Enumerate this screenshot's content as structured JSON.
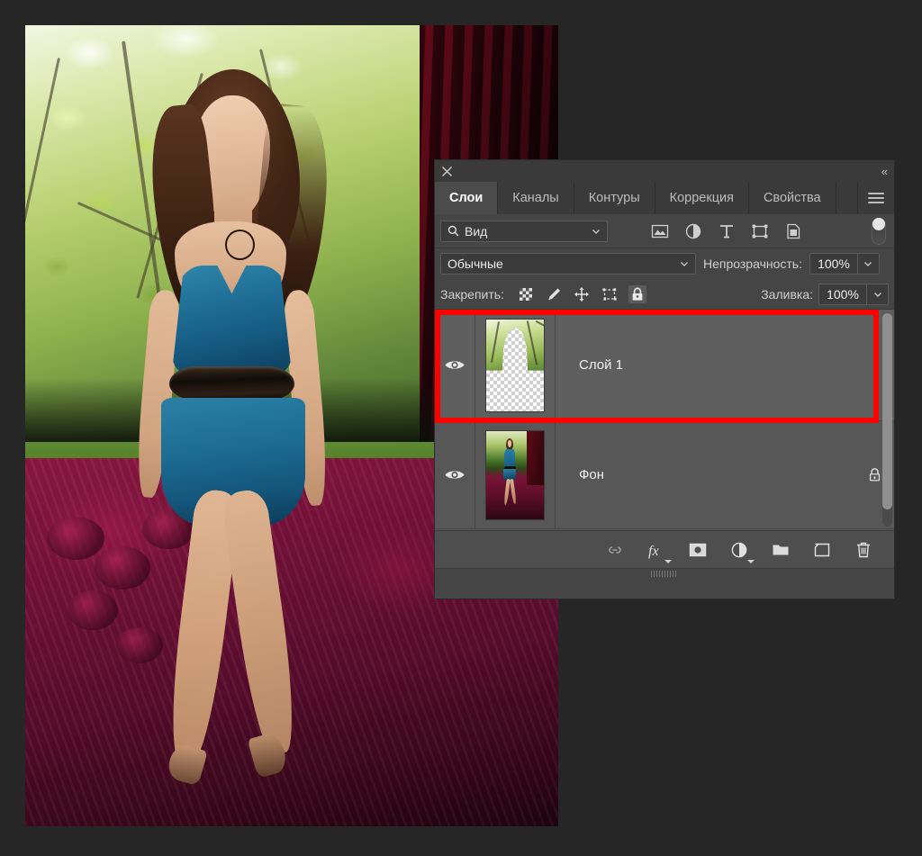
{
  "canvas": {
    "image_alt": "woman-in-blue-dress-on-velvet-sofa"
  },
  "panel": {
    "close_icon": "close-icon",
    "collapse_label": "«",
    "tabs": [
      {
        "label": "Слои",
        "active": true
      },
      {
        "label": "Каналы",
        "active": false
      },
      {
        "label": "Контуры",
        "active": false
      },
      {
        "label": "Коррекция",
        "active": false
      },
      {
        "label": "Свойства",
        "active": false
      }
    ],
    "menu_icon": "hamburger-menu-icon",
    "filter": {
      "kind_label": "Вид",
      "search_icon": "search-icon",
      "icons": [
        "pixel-layer-filter-icon",
        "adjustment-layer-filter-icon",
        "type-layer-filter-icon",
        "shape-layer-filter-icon",
        "smart-object-filter-icon"
      ],
      "toggle": "filter-enable-toggle"
    },
    "blend": {
      "mode": "Обычные",
      "opacity_label": "Непрозрачность:",
      "opacity_value": "100%",
      "fill_label": "Заливка:",
      "fill_value": "100%"
    },
    "lock": {
      "label": "Закрепить:",
      "icons": [
        "lock-transparent-pixels-icon",
        "lock-image-pixels-icon",
        "lock-position-icon",
        "lock-artboard-nesting-icon",
        "lock-all-icon"
      ],
      "active_index": 4
    },
    "layers": [
      {
        "name": "Слой 1",
        "visible": true,
        "selected": true,
        "locked": false,
        "thumb": "cutout-transparent-thumbnail"
      },
      {
        "name": "Фон",
        "visible": true,
        "selected": false,
        "locked": true,
        "thumb": "background-photo-thumbnail"
      }
    ],
    "bottom_icons": [
      "link-layers-icon",
      "layer-style-fx-icon",
      "add-layer-mask-icon",
      "new-adjustment-layer-icon",
      "new-group-icon",
      "new-layer-icon",
      "delete-layer-icon"
    ],
    "bottom_fx_label": "fx"
  },
  "colors": {
    "highlight": "#ff0000",
    "panel_bg": "#454545",
    "tab_bar": "#3a3a3a",
    "layer_row": "#5e5e5e",
    "desktop": "#262626"
  }
}
